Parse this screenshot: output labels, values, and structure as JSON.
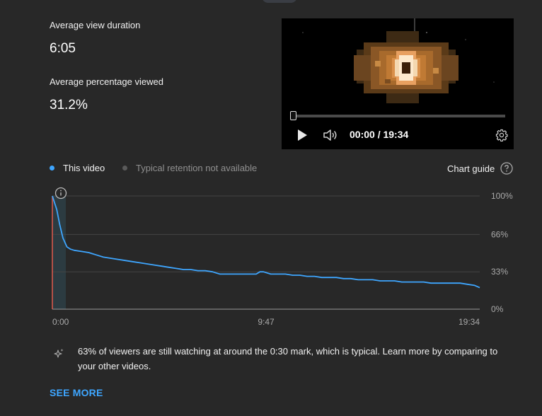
{
  "metrics": {
    "avg_view_duration_label": "Average view duration",
    "avg_view_duration_value": "6:05",
    "avg_pct_viewed_label": "Average percentage viewed",
    "avg_pct_viewed_value": "31.2%"
  },
  "player": {
    "time_display": "00:00 / 19:34",
    "play_icon": "play-icon",
    "volume_icon": "volume-icon",
    "settings_icon": "gear-icon"
  },
  "legend": {
    "this_video": "This video",
    "typical": "Typical retention not available",
    "chart_guide": "Chart guide"
  },
  "colors": {
    "background": "#282828",
    "series": "#3ea6ff",
    "accent_link": "#3ea6ff",
    "start_marker": "#e05a4e",
    "muted": "#909090"
  },
  "chart_data": {
    "type": "line",
    "title": "",
    "xlabel": "",
    "ylabel": "",
    "x_tick_labels": [
      "0:00",
      "9:47",
      "19:34"
    ],
    "y_tick_labels": [
      "100%",
      "66%",
      "33%",
      "0%"
    ],
    "x_unit": "seconds",
    "xlim": [
      0,
      1174
    ],
    "ylim": [
      0,
      100
    ],
    "grid": true,
    "series": [
      {
        "name": "This video",
        "x": [
          0,
          12,
          20,
          29,
          40,
          50,
          60,
          80,
          100,
          120,
          140,
          160,
          180,
          200,
          220,
          240,
          260,
          280,
          300,
          320,
          340,
          360,
          380,
          400,
          420,
          440,
          450,
          460,
          480,
          500,
          520,
          540,
          560,
          570,
          580,
          600,
          620,
          640,
          660,
          680,
          700,
          720,
          740,
          760,
          780,
          800,
          820,
          840,
          860,
          880,
          900,
          920,
          940,
          960,
          980,
          1000,
          1020,
          1040,
          1060,
          1080,
          1100,
          1120,
          1140,
          1160,
          1174
        ],
        "y": [
          100,
          88,
          75,
          63,
          55,
          53,
          52,
          51,
          50,
          48,
          46,
          45,
          44,
          43,
          42,
          41,
          40,
          39,
          38,
          37,
          36,
          35,
          35,
          34,
          34,
          33,
          32,
          31,
          31,
          31,
          31,
          31,
          31,
          33,
          33,
          31,
          31,
          31,
          30,
          30,
          29,
          29,
          28,
          28,
          28,
          27,
          27,
          26,
          26,
          26,
          25,
          25,
          25,
          24,
          24,
          24,
          24,
          23,
          23,
          23,
          23,
          23,
          22,
          21,
          19
        ]
      }
    ],
    "annotation": {
      "insight_text": "63% of viewers are still watching at around the 0:30 mark, which is typical. Learn more by comparing to your other videos.",
      "highlight_end": 37,
      "info_icon": "info-icon"
    }
  },
  "insight": {
    "icon": "sparkle-icon",
    "text": "63% of viewers are still watching at around the 0:30 mark, which is typical. Learn more by comparing to your other videos.",
    "see_more": "SEE MORE"
  }
}
